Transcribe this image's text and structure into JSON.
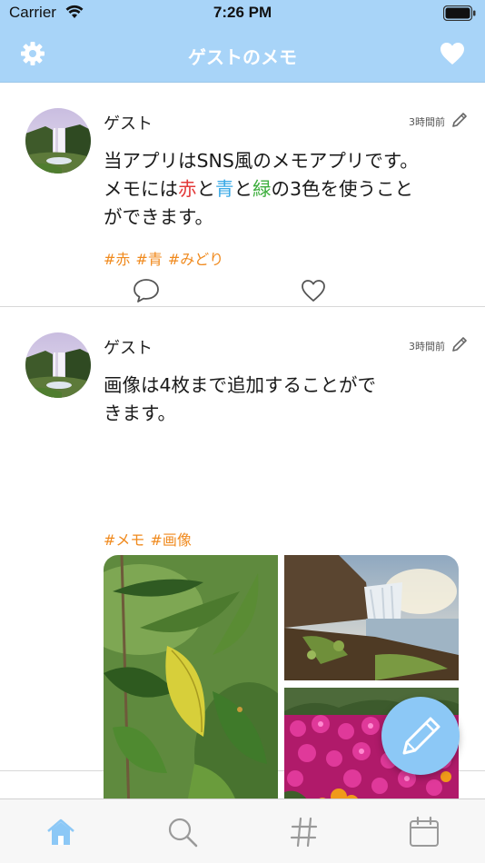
{
  "status_bar": {
    "carrier": "Carrier",
    "time": "7:26 PM"
  },
  "nav": {
    "title": "ゲストのメモ",
    "left_icon": "gear-icon",
    "right_icon": "heart-icon"
  },
  "colors": {
    "nav_bg": "#a8d4f8",
    "accent": "#8cc8f6",
    "tag": "#f08a1e",
    "red": "#e33a3a",
    "blue": "#3aa9e6",
    "green": "#3cae3c"
  },
  "posts": [
    {
      "author": "ゲスト",
      "time": "3時間前",
      "text": {
        "line1": "当アプリはSNS風のメモアプリです。",
        "line2_pre": "メモには",
        "red": "赤",
        "and1": "と",
        "blue": "青",
        "and2": "と",
        "green": "緑",
        "line2_post": "の3色を使うこと",
        "line3": "ができます。"
      },
      "tags": [
        "#赤",
        "#青",
        "#みどり"
      ]
    },
    {
      "author": "ゲスト",
      "time": "3時間前",
      "text": {
        "line1": "画像は4枚まで追加することがで",
        "line2": "きます。"
      },
      "tags": [
        "#メモ",
        "#画像"
      ],
      "images": [
        "leaf-photo",
        "waterfall-photo",
        "flowers-photo"
      ]
    }
  ],
  "tab_bar": {
    "items": [
      {
        "icon": "home-icon",
        "active": true
      },
      {
        "icon": "search-icon",
        "active": false
      },
      {
        "icon": "hashtag-icon",
        "active": false
      },
      {
        "icon": "calendar-icon",
        "active": false
      }
    ]
  },
  "fab": {
    "icon": "pencil-icon"
  }
}
